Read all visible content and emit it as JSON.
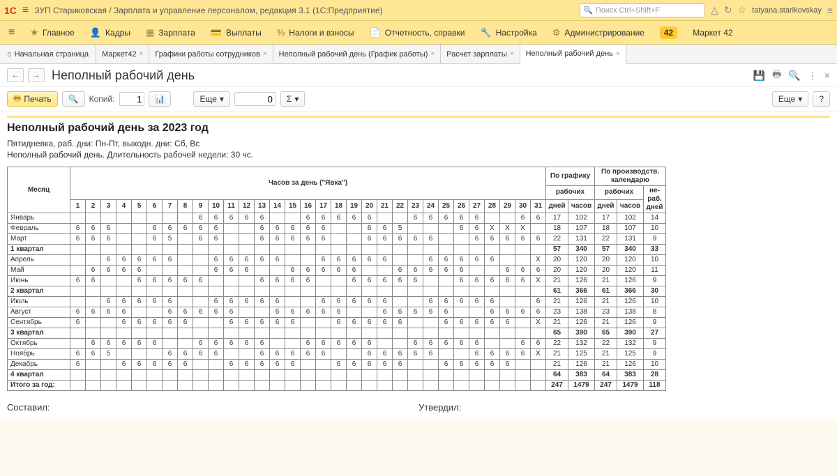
{
  "header": {
    "logo": "1С",
    "title": "ЗУП Стариковская / Зарплата и управление персоналом, редакция 3.1 (1С:Предприятие)",
    "search_placeholder": "Поиск Ctrl+Shift+F",
    "user": "tatyana.starikovskay"
  },
  "nav": {
    "items": [
      {
        "label": "Главное",
        "ico": "★"
      },
      {
        "label": "Кадры",
        "ico": "👤"
      },
      {
        "label": "Зарплата",
        "ico": "▦"
      },
      {
        "label": "Выплаты",
        "ico": "💳"
      },
      {
        "label": "Налоги и взносы",
        "ico": "%"
      },
      {
        "label": "Отчетность, справки",
        "ico": "📄"
      },
      {
        "label": "Настройка",
        "ico": "🔧"
      },
      {
        "label": "Администрирование",
        "ico": "⚙"
      }
    ],
    "market_badge": "42",
    "market_label": "Маркет 42"
  },
  "tabs": {
    "home": "Начальная страница",
    "items": [
      {
        "label": "Маркет42",
        "active": false
      },
      {
        "label": "Графики работы сотрудников",
        "active": false
      },
      {
        "label": "Неполный рабочий день (График работы)",
        "active": false
      },
      {
        "label": "Расчет зарплаты",
        "active": false
      },
      {
        "label": "Неполный рабочий день",
        "active": true
      }
    ]
  },
  "page": {
    "title": "Неполный рабочий день",
    "print_label": "Печать",
    "copies_label": "Копий:",
    "copies_value": "1",
    "more_label": "Еще",
    "zero_field": "0",
    "sigma": "Σ",
    "more2": "Еще",
    "help": "?"
  },
  "report": {
    "heading": "Неполный рабочий день за 2023 год",
    "line1": "Пятидневка, раб. дни: Пн-Пт, выходн. дни: Сб, Вс",
    "line2": "Неполный рабочий день. Длительность рабочей недели: 30 чс.",
    "col_month": "Месяц",
    "col_hours": "Часов за день (\"Явка\")",
    "col_graf": "По графику",
    "col_prod": "По производств. календарю",
    "sub_rab": "рабочих",
    "sub_nerab": "не-раб. дней",
    "sub_days": "дней",
    "sub_hours": "часов",
    "days": [
      "1",
      "2",
      "3",
      "4",
      "5",
      "6",
      "7",
      "8",
      "9",
      "10",
      "11",
      "12",
      "13",
      "14",
      "15",
      "16",
      "17",
      "18",
      "19",
      "20",
      "21",
      "22",
      "23",
      "24",
      "25",
      "26",
      "27",
      "28",
      "29",
      "30",
      "31"
    ],
    "rows": [
      {
        "m": "Январь",
        "d": [
          "",
          "",
          "",
          "",
          "",
          "",
          "",
          "",
          "6",
          "6",
          "6",
          "6",
          "6",
          "",
          "",
          "6",
          "6",
          "6",
          "6",
          "6",
          "",
          "",
          "6",
          "6",
          "6",
          "6",
          "6",
          "",
          "",
          "6",
          "6"
        ],
        "g_d": "17",
        "g_h": "102",
        "p_d": "17",
        "p_h": "102",
        "nr": "14"
      },
      {
        "m": "Февраль",
        "d": [
          "6",
          "6",
          "6",
          "",
          "",
          "6",
          "6",
          "6",
          "6",
          "6",
          "",
          "",
          "6",
          "6",
          "6",
          "6",
          "6",
          "",
          "",
          "6",
          "6",
          "5",
          "",
          "",
          "",
          "6",
          "6",
          "Х",
          "Х",
          "Х",
          ""
        ],
        "g_d": "18",
        "g_h": "107",
        "p_d": "18",
        "p_h": "107",
        "nr": "10"
      },
      {
        "m": "Март",
        "d": [
          "6",
          "6",
          "6",
          "",
          "",
          "6",
          "5",
          "",
          "6",
          "6",
          "",
          "",
          "6",
          "6",
          "6",
          "6",
          "6",
          "",
          "",
          "6",
          "6",
          "6",
          "6",
          "6",
          "",
          "",
          "6",
          "6",
          "6",
          "6",
          "6"
        ],
        "g_d": "22",
        "g_h": "131",
        "p_d": "22",
        "p_h": "131",
        "nr": "9"
      },
      {
        "m": "1 квартал",
        "d": [
          "",
          "",
          "",
          "",
          "",
          "",
          "",
          "",
          "",
          "",
          "",
          "",
          "",
          "",
          "",
          "",
          "",
          "",
          "",
          "",
          "",
          "",
          "",
          "",
          "",
          "",
          "",
          "",
          "",
          "",
          ""
        ],
        "g_d": "57",
        "g_h": "340",
        "p_d": "57",
        "p_h": "340",
        "nr": "33",
        "q": true
      },
      {
        "m": "Апрель",
        "d": [
          "",
          "",
          "6",
          "6",
          "6",
          "6",
          "6",
          "",
          "",
          "6",
          "6",
          "6",
          "6",
          "6",
          "",
          "",
          "6",
          "6",
          "6",
          "6",
          "6",
          "",
          "",
          "6",
          "6",
          "6",
          "6",
          "6",
          "",
          "",
          "Х"
        ],
        "g_d": "20",
        "g_h": "120",
        "p_d": "20",
        "p_h": "120",
        "nr": "10"
      },
      {
        "m": "Май",
        "d": [
          "",
          "6",
          "6",
          "6",
          "6",
          "",
          "",
          "",
          "",
          "6",
          "6",
          "6",
          "",
          "",
          "6",
          "6",
          "6",
          "6",
          "6",
          "",
          "",
          "6",
          "6",
          "6",
          "6",
          "6",
          "",
          "",
          "6",
          "6",
          "6"
        ],
        "g_d": "20",
        "g_h": "120",
        "p_d": "20",
        "p_h": "120",
        "nr": "11"
      },
      {
        "m": "Июнь",
        "d": [
          "6",
          "6",
          "",
          "",
          "6",
          "6",
          "6",
          "6",
          "6",
          "",
          "",
          "",
          "6",
          "6",
          "6",
          "6",
          "",
          "",
          "6",
          "6",
          "6",
          "6",
          "6",
          "",
          "",
          "6",
          "6",
          "6",
          "6",
          "6",
          "Х"
        ],
        "g_d": "21",
        "g_h": "126",
        "p_d": "21",
        "p_h": "126",
        "nr": "9"
      },
      {
        "m": "2 квартал",
        "d": [
          "",
          "",
          "",
          "",
          "",
          "",
          "",
          "",
          "",
          "",
          "",
          "",
          "",
          "",
          "",
          "",
          "",
          "",
          "",
          "",
          "",
          "",
          "",
          "",
          "",
          "",
          "",
          "",
          "",
          "",
          ""
        ],
        "g_d": "61",
        "g_h": "366",
        "p_d": "61",
        "p_h": "366",
        "nr": "30",
        "q": true
      },
      {
        "m": "Июль",
        "d": [
          "",
          "",
          "6",
          "6",
          "6",
          "6",
          "6",
          "",
          "",
          "6",
          "6",
          "6",
          "6",
          "6",
          "",
          "",
          "6",
          "6",
          "6",
          "6",
          "6",
          "",
          "",
          "6",
          "6",
          "6",
          "6",
          "6",
          "",
          "",
          "6"
        ],
        "g_d": "21",
        "g_h": "126",
        "p_d": "21",
        "p_h": "126",
        "nr": "10"
      },
      {
        "m": "Август",
        "d": [
          "6",
          "6",
          "6",
          "6",
          "",
          "",
          "6",
          "6",
          "6",
          "6",
          "6",
          "",
          "",
          "6",
          "6",
          "6",
          "6",
          "6",
          "",
          "",
          "6",
          "6",
          "6",
          "6",
          "6",
          "",
          "",
          "6",
          "6",
          "6",
          "6"
        ],
        "g_d": "23",
        "g_h": "138",
        "p_d": "23",
        "p_h": "138",
        "nr": "8"
      },
      {
        "m": "Сентябрь",
        "d": [
          "6",
          "",
          "",
          "6",
          "6",
          "6",
          "6",
          "6",
          "",
          "",
          "6",
          "6",
          "6",
          "6",
          "6",
          "",
          "",
          "6",
          "6",
          "6",
          "6",
          "6",
          "",
          "",
          "6",
          "6",
          "6",
          "6",
          "6",
          "",
          "Х"
        ],
        "g_d": "21",
        "g_h": "126",
        "p_d": "21",
        "p_h": "126",
        "nr": "9"
      },
      {
        "m": "3 квартал",
        "d": [
          "",
          "",
          "",
          "",
          "",
          "",
          "",
          "",
          "",
          "",
          "",
          "",
          "",
          "",
          "",
          "",
          "",
          "",
          "",
          "",
          "",
          "",
          "",
          "",
          "",
          "",
          "",
          "",
          "",
          "",
          ""
        ],
        "g_d": "65",
        "g_h": "390",
        "p_d": "65",
        "p_h": "390",
        "nr": "27",
        "q": true
      },
      {
        "m": "Октябрь",
        "d": [
          "",
          "6",
          "6",
          "6",
          "6",
          "6",
          "",
          "",
          "6",
          "6",
          "6",
          "6",
          "6",
          "",
          "",
          "6",
          "6",
          "6",
          "6",
          "6",
          "",
          "",
          "6",
          "6",
          "6",
          "6",
          "6",
          "",
          "",
          "6",
          "6"
        ],
        "g_d": "22",
        "g_h": "132",
        "p_d": "22",
        "p_h": "132",
        "nr": "9"
      },
      {
        "m": "Ноябрь",
        "d": [
          "6",
          "6",
          "5",
          "",
          "",
          "",
          "6",
          "6",
          "6",
          "6",
          "",
          "",
          "6",
          "6",
          "6",
          "6",
          "6",
          "",
          "",
          "6",
          "6",
          "6",
          "6",
          "6",
          "",
          "",
          "6",
          "6",
          "6",
          "6",
          "Х"
        ],
        "g_d": "21",
        "g_h": "125",
        "p_d": "21",
        "p_h": "125",
        "nr": "9"
      },
      {
        "m": "Декабрь",
        "d": [
          "6",
          "",
          "",
          "6",
          "6",
          "6",
          "6",
          "6",
          "",
          "",
          "6",
          "6",
          "6",
          "6",
          "6",
          "",
          "",
          "6",
          "6",
          "6",
          "6",
          "6",
          "",
          "",
          "6",
          "6",
          "6",
          "6",
          "6",
          "",
          ""
        ],
        "g_d": "21",
        "g_h": "126",
        "p_d": "21",
        "p_h": "126",
        "nr": "10"
      },
      {
        "m": "4 квартал",
        "d": [
          "",
          "",
          "",
          "",
          "",
          "",
          "",
          "",
          "",
          "",
          "",
          "",
          "",
          "",
          "",
          "",
          "",
          "",
          "",
          "",
          "",
          "",
          "",
          "",
          "",
          "",
          "",
          "",
          "",
          "",
          ""
        ],
        "g_d": "64",
        "g_h": "383",
        "p_d": "64",
        "p_h": "383",
        "nr": "28",
        "q": true
      },
      {
        "m": "Итого за год:",
        "d": [
          "",
          "",
          "",
          "",
          "",
          "",
          "",
          "",
          "",
          "",
          "",
          "",
          "",
          "",
          "",
          "",
          "",
          "",
          "",
          "",
          "",
          "",
          "",
          "",
          "",
          "",
          "",
          "",
          "",
          "",
          ""
        ],
        "g_d": "247",
        "g_h": "1479",
        "p_d": "247",
        "p_h": "1479",
        "nr": "118",
        "q": true,
        "ty": true
      }
    ],
    "sig_prepared": "Составил:",
    "sig_approved": "Утвердил:"
  },
  "glyphs": {
    "home": "⌂",
    "search": "🔍",
    "bell": "△",
    "history": "↻",
    "star": "☆",
    "menu": "≡",
    "save": "💾",
    "print2": "🖶",
    "mag": "🔍",
    "dots": "⋮",
    "close": "×",
    "back": "←",
    "fwd": "→",
    "dropdown": "▾",
    "chart": "📊",
    "lookup": "🔍"
  }
}
